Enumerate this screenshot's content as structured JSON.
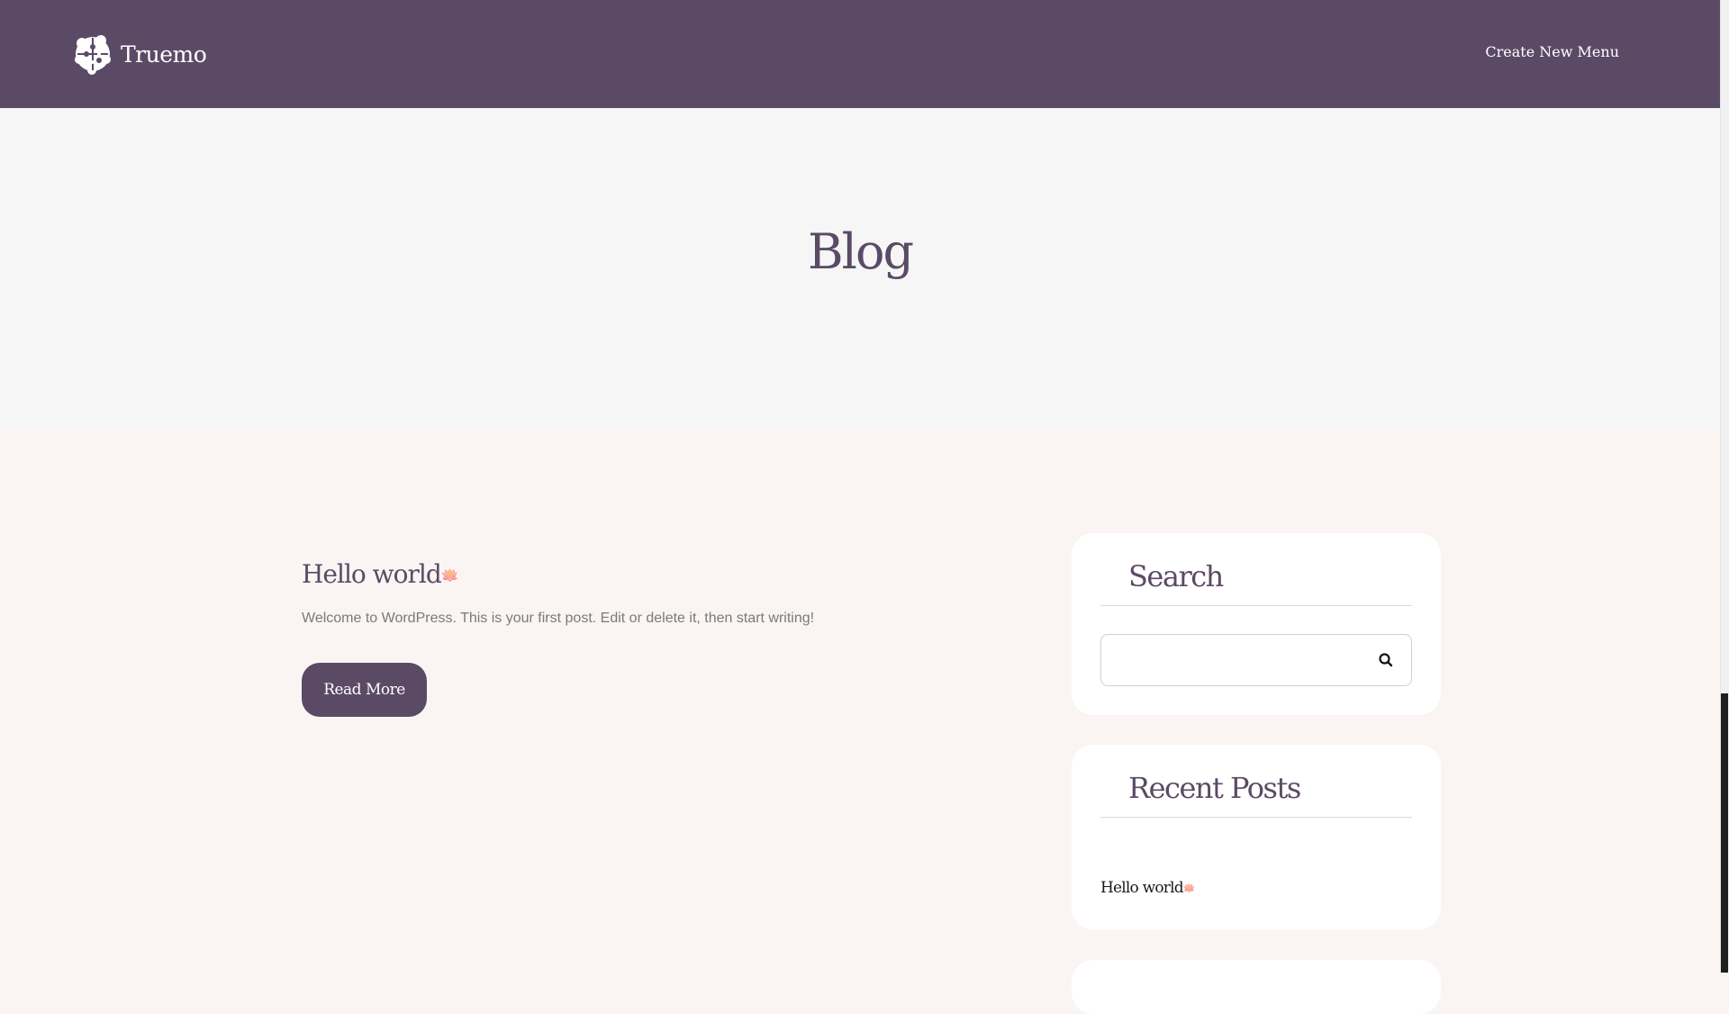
{
  "header": {
    "site_name": "Truemo",
    "logo_icon": "brain-puzzle-icon",
    "nav_link": "Create New Menu",
    "background": "#5b4a66"
  },
  "hero": {
    "title": "Blog",
    "background": "#f5f6f5"
  },
  "post": {
    "title": "Hello world",
    "title_emoji": "🪷",
    "excerpt": "Welcome to WordPress. This is your first post. Edit or delete it, then start writing!",
    "button_label": "Read More"
  },
  "sidebar": {
    "search": {
      "title": "Search",
      "placeholder": "",
      "button_icon": "search-icon"
    },
    "recent_posts": {
      "title": "Recent Posts",
      "items": [
        {
          "label": "Hello world",
          "emoji": "🪷"
        }
      ]
    }
  },
  "colors": {
    "accent": "#5b4a66",
    "page_background": "#faf5f3",
    "card_background": "#ffffff",
    "body_text": "#7a7a7a"
  }
}
